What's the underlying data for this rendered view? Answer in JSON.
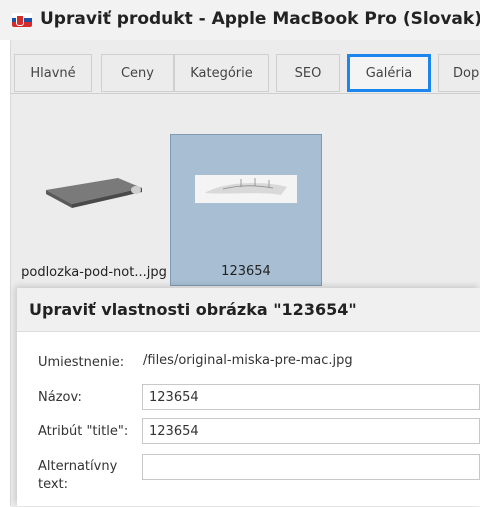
{
  "header": {
    "title": "Upraviť produkt - Apple MacBook Pro (Slovak)"
  },
  "tabs": [
    {
      "label": "Hlavné",
      "active": false
    },
    {
      "label": "Ceny",
      "active": false
    },
    {
      "label": "Kategórie",
      "active": false
    },
    {
      "label": "SEO",
      "active": false
    },
    {
      "label": "Galéria",
      "active": true
    },
    {
      "label": "Dopl",
      "active": false
    }
  ],
  "gallery": {
    "items": [
      {
        "label": "podlozka-pod-not...jpg",
        "selected": false
      },
      {
        "label": "123654",
        "selected": true
      }
    ]
  },
  "dialog": {
    "title": "Upraviť vlastnosti obrázka \"123654\"",
    "location_label": "Umiestnenie:",
    "location_value": "/files/original-miska-pre-mac.jpg",
    "name_label": "Názov:",
    "name_value": "123654",
    "title_attr_label": "Atribút \"title\":",
    "title_attr_value": "123654",
    "alt_label": "Alternatívny text:",
    "alt_value": ""
  },
  "colors": {
    "active_tab_border": "#1c86ee",
    "selected_thumb_bg": "#a8bfd3"
  }
}
